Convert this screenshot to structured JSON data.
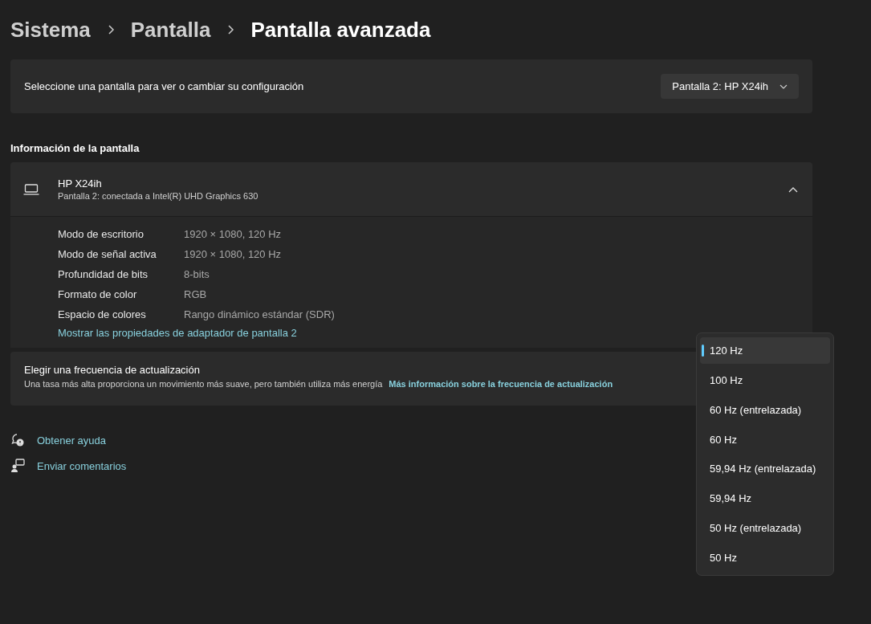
{
  "breadcrumb": [
    {
      "label": "Sistema",
      "current": false
    },
    {
      "label": "Pantalla",
      "current": false
    },
    {
      "label": "Pantalla avanzada",
      "current": true
    }
  ],
  "display_select": {
    "label": "Seleccione una pantalla para ver o cambiar su configuración",
    "value": "Pantalla 2: HP X24ih"
  },
  "section_title": "Información de la pantalla",
  "display_info": {
    "name": "HP X24ih",
    "subtitle": "Pantalla 2: conectada a Intel(R) UHD Graphics 630",
    "expanded": true,
    "rows": [
      {
        "label": "Modo de escritorio",
        "value": "1920 × 1080, 120 Hz"
      },
      {
        "label": "Modo de señal activa",
        "value": "1920 × 1080, 120 Hz"
      },
      {
        "label": "Profundidad de bits",
        "value": "8-bits"
      },
      {
        "label": "Formato de color",
        "value": "RGB"
      },
      {
        "label": "Espacio de colores",
        "value": "Rango dinámico estándar (SDR)"
      }
    ],
    "link": "Mostrar las propiedades de adaptador de pantalla 2"
  },
  "refresh_rate": {
    "title": "Elegir una frecuencia de actualización",
    "description": "Una tasa más alta proporciona un movimiento más suave, pero también utiliza más energía",
    "link": "Más información sobre la frecuencia de actualización",
    "options": [
      {
        "label": "120 Hz",
        "selected": true
      },
      {
        "label": "100 Hz",
        "selected": false
      },
      {
        "label": "60 Hz (entrelazada)",
        "selected": false
      },
      {
        "label": "60 Hz",
        "selected": false
      },
      {
        "label": "59,94 Hz (entrelazada)",
        "selected": false
      },
      {
        "label": "59,94 Hz",
        "selected": false
      },
      {
        "label": "50 Hz (entrelazada)",
        "selected": false
      },
      {
        "label": "50 Hz",
        "selected": false
      }
    ]
  },
  "footer_links": [
    {
      "kind": "help",
      "label": "Obtener ayuda"
    },
    {
      "kind": "feedback",
      "label": "Enviar comentarios"
    }
  ]
}
